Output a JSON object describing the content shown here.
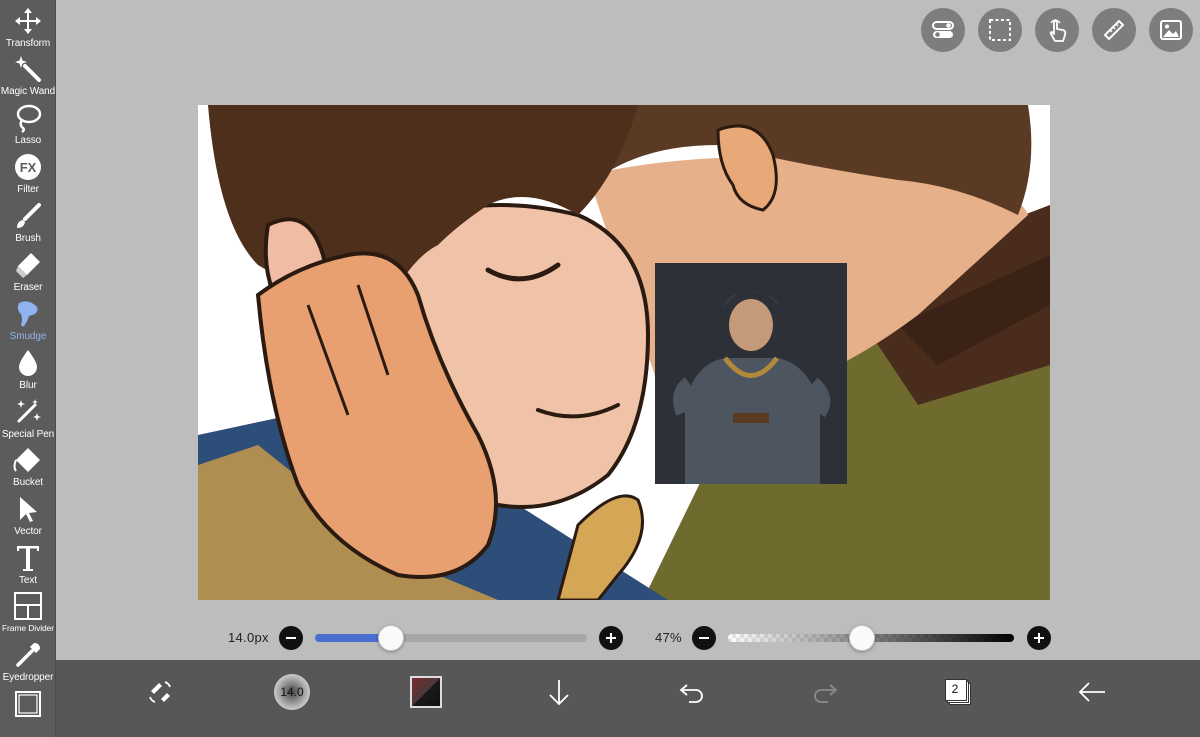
{
  "toolbar": {
    "tools": [
      {
        "label": "Transform",
        "icon": "move-arrows-icon",
        "active": false
      },
      {
        "label": "Magic Wand",
        "icon": "magic-wand-icon",
        "active": false
      },
      {
        "label": "Lasso",
        "icon": "lasso-icon",
        "active": false
      },
      {
        "label": "Filter",
        "icon": "fx-filter-icon",
        "active": false
      },
      {
        "label": "Brush",
        "icon": "brush-icon",
        "active": false
      },
      {
        "label": "Eraser",
        "icon": "eraser-icon",
        "active": false
      },
      {
        "label": "Smudge",
        "icon": "smudge-finger-icon",
        "active": true
      },
      {
        "label": "Blur",
        "icon": "blur-drop-icon",
        "active": false
      },
      {
        "label": "Special Pen",
        "icon": "sparkle-pen-icon",
        "active": false
      },
      {
        "label": "Bucket",
        "icon": "bucket-icon",
        "active": false
      },
      {
        "label": "Vector",
        "icon": "vector-cursor-icon",
        "active": false
      },
      {
        "label": "Text",
        "icon": "text-t-icon",
        "active": false
      },
      {
        "label": "Frame Divider",
        "icon": "frame-divider-icon",
        "active": false
      },
      {
        "label": "Eyedropper",
        "icon": "eyedropper-icon",
        "active": false
      },
      {
        "label": "",
        "icon": "canvas-frame-icon",
        "active": false
      }
    ],
    "active_color": "#8fb2f0"
  },
  "top_buttons": [
    {
      "icon": "toggle-switches-icon"
    },
    {
      "icon": "selection-marquee-icon"
    },
    {
      "icon": "touch-hand-icon"
    },
    {
      "icon": "ruler-icon"
    },
    {
      "icon": "image-reference-icon"
    }
  ],
  "sliders": {
    "size": {
      "value_text": "14.0px",
      "fraction": 0.28
    },
    "opacity": {
      "value_text": "47%",
      "fraction": 0.47
    }
  },
  "bottom_bar": {
    "brush_size_text": "14.0",
    "layer_count": "2",
    "icons": [
      "swap-tool-icon",
      "brush-size-icon",
      "color-swatch-icon",
      "download-arrow-icon",
      "undo-icon",
      "redo-icon",
      "layers-icon",
      "back-arrow-icon"
    ]
  },
  "colors": {
    "toolbar_bg": "#5c5c5c",
    "workspace_bg": "#bdbdbd",
    "slider_accent": "#4a6fd0",
    "bottom_bar_bg": "#575757"
  }
}
